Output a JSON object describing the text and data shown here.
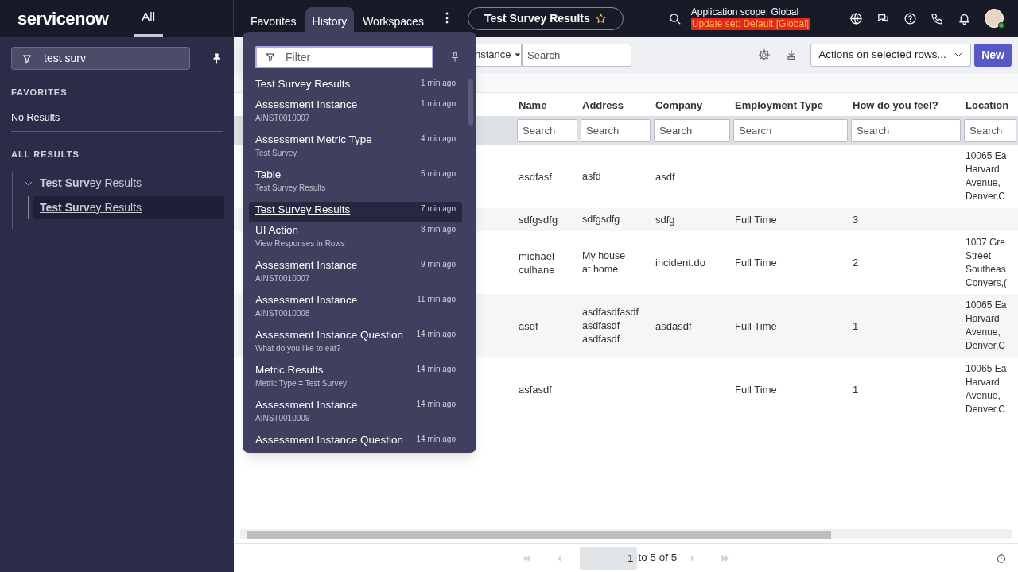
{
  "logo": "servicenow",
  "nav_tabs": [
    {
      "label": "All",
      "selected": true
    },
    {
      "label": "Favorites",
      "selected": false
    },
    {
      "label": "History",
      "selected": true
    },
    {
      "label": "Workspaces",
      "selected": false
    }
  ],
  "more_menu": "⋮",
  "current_page": {
    "title": "Test Survey Results"
  },
  "scope": {
    "application": "Application scope: Global",
    "update_set": "Update set: Default [Global]"
  },
  "sidebar": {
    "filter": {
      "value": "test surv"
    },
    "favorites": {
      "heading": "FAVORITES",
      "empty": "No Results"
    },
    "all_results": {
      "heading": "ALL RESULTS",
      "items": [
        {
          "label": "**Test Surv**ey Results",
          "expanded": true,
          "selected": false,
          "children": [
            {
              "label": "**Test Surv**ey Results",
              "selected": true
            }
          ]
        }
      ]
    }
  },
  "history": {
    "filter": {
      "placeholder": "Filter"
    },
    "items": [
      {
        "title": "Test Survey Results",
        "time": "1 min ago",
        "selected": false
      },
      {
        "title": "Assessment Instance",
        "subtitle": "AINST0010007",
        "time": "1 min ago",
        "selected": false
      },
      {
        "title": "Assessment Metric Type",
        "subtitle": "Test Survey",
        "time": "4 min ago",
        "selected": false
      },
      {
        "title": "Table",
        "subtitle": "Test Survey Results",
        "time": "5 min ago",
        "selected": false
      },
      {
        "title": "Test Survey Results",
        "time": "7 min ago",
        "selected": true
      },
      {
        "title": "UI Action",
        "subtitle": "View Responses in Rows",
        "time": "8 min ago",
        "selected": false
      },
      {
        "title": "Assessment Instance",
        "subtitle": "AINST0010007",
        "time": "9 min ago",
        "selected": false
      },
      {
        "title": "Assessment Instance",
        "subtitle": "AINST0010008",
        "time": "11 min ago",
        "selected": false
      },
      {
        "title": "Assessment Instance Question",
        "subtitle": "What do you like to eat?",
        "time": "14 min ago",
        "selected": false
      },
      {
        "title": "Metric Results",
        "subtitle": "Metric Type = Test Survey",
        "time": "14 min ago",
        "selected": false
      },
      {
        "title": "Assessment Instance",
        "subtitle": "AINST0010009",
        "time": "14 min ago",
        "selected": false
      },
      {
        "title": "Assessment Instance Question",
        "time": "14 min ago",
        "selected": false
      }
    ]
  },
  "toolbar": {
    "field_select": "nstance",
    "search": {
      "placeholder": "Search"
    },
    "actions": "Actions on selected rows...",
    "new_button": "New"
  },
  "table": {
    "columns": [
      {
        "label": "Name",
        "placeholder": "Search"
      },
      {
        "label": "Address",
        "placeholder": "Search"
      },
      {
        "label": "Company",
        "placeholder": "Search"
      },
      {
        "label": "Employment Type",
        "placeholder": "Search"
      },
      {
        "label": "How do you feel?",
        "placeholder": "Search"
      },
      {
        "label": "Location",
        "placeholder": "Search"
      }
    ],
    "rows": [
      {
        "name": "asdfasf",
        "address": [
          "asfd"
        ],
        "company": "asdf",
        "location": [
          "10065 Ea",
          "Harvard",
          "Avenue,",
          "Denver,C"
        ]
      },
      {
        "name": "sdfgsdfg",
        "address": [
          "sdfgsdfg"
        ],
        "company": "sdfg",
        "employment_type": "Full Time",
        "how_do_you_feel": "3"
      },
      {
        "name": "michael culhane",
        "address": [
          "My house",
          "at home"
        ],
        "company": "incident.do",
        "employment_type": "Full Time",
        "how_do_you_feel": "2",
        "location": [
          "1007 Gre",
          "Street",
          "Southeas",
          "Conyers,("
        ]
      },
      {
        "name": "asdf",
        "address": [
          "asdfasdfasdf",
          "asdfasdf",
          "asdfasdf"
        ],
        "company": "asdasdf",
        "employment_type": "Full Time",
        "how_do_you_feel": "1",
        "location": [
          "10065 Ea",
          "Harvard",
          "Avenue,",
          "Denver,C"
        ]
      },
      {
        "name": "asfasdf",
        "employment_type": "Full Time",
        "how_do_you_feel": "1",
        "location": [
          "10065 Ea",
          "Harvard",
          "Avenue,",
          "Denver,C"
        ]
      }
    ]
  },
  "pagination": {
    "page": "1",
    "range": "to 5 of 5"
  }
}
